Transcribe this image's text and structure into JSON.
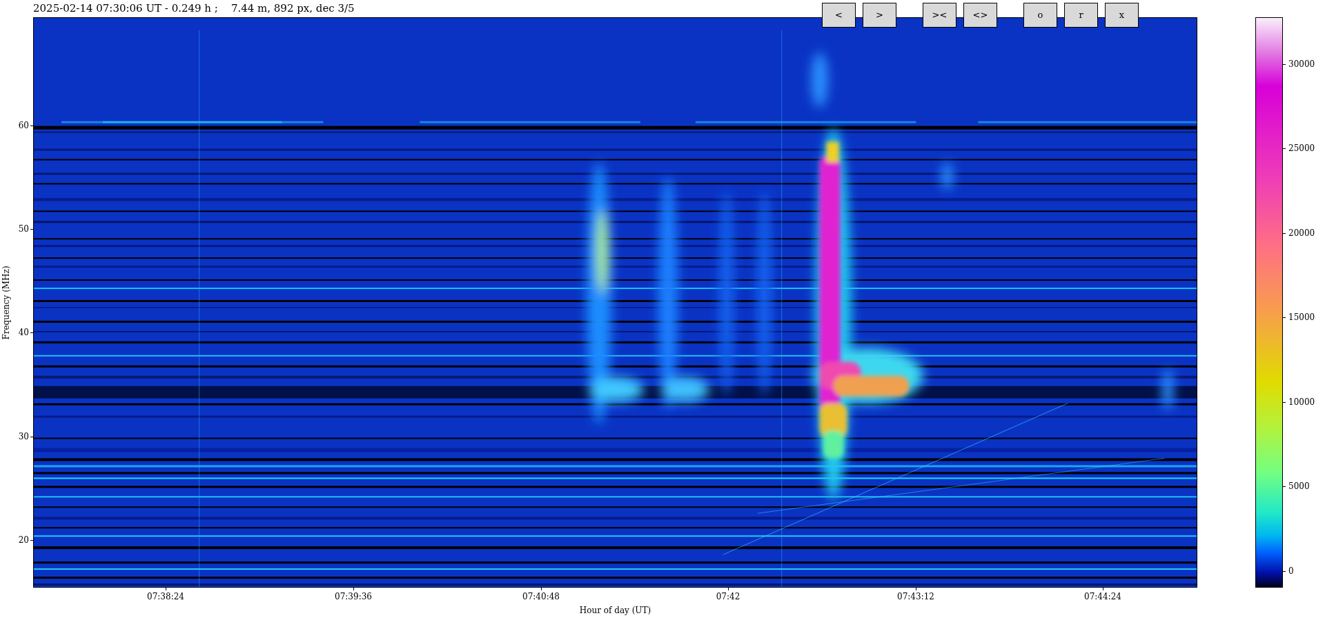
{
  "title": "2025-02-14 07:30:06 UT - 0.249 h ;    7.44 m, 892 px, dec 3/5",
  "toolbar": [
    {
      "buttons": [
        "<",
        ">"
      ]
    },
    {
      "buttons": [
        "><",
        "<>"
      ]
    },
    {
      "buttons": [
        "o",
        "r",
        "x"
      ]
    }
  ],
  "plot": {
    "ylabel": "Frequency (MHz)",
    "xlabel": "Hour of day (UT)",
    "yticks": [
      "60",
      "50",
      "40",
      "30",
      "20"
    ],
    "xticks": [
      "07:38:24",
      "07:39:36",
      "07:40:48",
      "07:42",
      "07:43:12",
      "07:44:24"
    ]
  },
  "colorbar": {
    "ticks": [
      "30000",
      "25000",
      "20000",
      "15000",
      "10000",
      "5000",
      "0"
    ]
  }
}
